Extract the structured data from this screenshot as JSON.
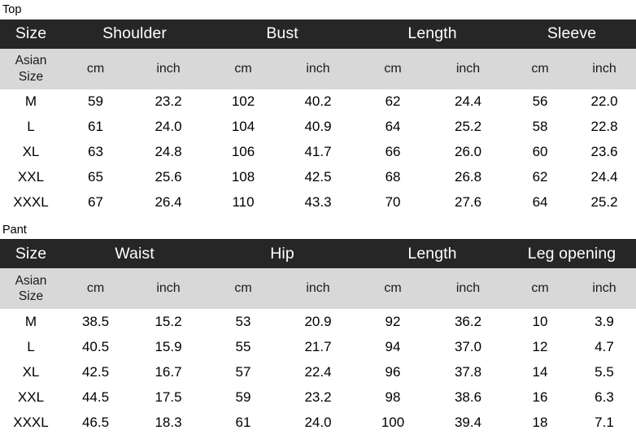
{
  "tables": [
    {
      "label": "Top",
      "group_headers": [
        "Size",
        "Shoulder",
        "Bust",
        "Length",
        "Sleeve"
      ],
      "size_header": "Asian\nSize",
      "size_header_line1": "Asian",
      "size_header_line2": "Size",
      "unit_headers": [
        "cm",
        "inch",
        "cm",
        "inch",
        "cm",
        "inch",
        "cm",
        "inch"
      ],
      "rows": [
        {
          "size": "M",
          "cells": [
            "59",
            "23.2",
            "102",
            "40.2",
            "62",
            "24.4",
            "56",
            "22.0"
          ]
        },
        {
          "size": "L",
          "cells": [
            "61",
            "24.0",
            "104",
            "40.9",
            "64",
            "25.2",
            "58",
            "22.8"
          ]
        },
        {
          "size": "XL",
          "cells": [
            "63",
            "24.8",
            "106",
            "41.7",
            "66",
            "26.0",
            "60",
            "23.6"
          ]
        },
        {
          "size": "XXL",
          "cells": [
            "65",
            "25.6",
            "108",
            "42.5",
            "68",
            "26.8",
            "62",
            "24.4"
          ]
        },
        {
          "size": "XXXL",
          "cells": [
            "67",
            "26.4",
            "110",
            "43.3",
            "70",
            "27.6",
            "64",
            "25.2"
          ]
        }
      ]
    },
    {
      "label": "Pant",
      "group_headers": [
        "Size",
        "Waist",
        "Hip",
        "Length",
        "Leg opening"
      ],
      "size_header_line1": "Asian",
      "size_header_line2": "Size",
      "unit_headers": [
        "cm",
        "inch",
        "cm",
        "inch",
        "cm",
        "inch",
        "cm",
        "inch"
      ],
      "rows": [
        {
          "size": "M",
          "cells": [
            "38.5",
            "15.2",
            "53",
            "20.9",
            "92",
            "36.2",
            "10",
            "3.9"
          ]
        },
        {
          "size": "L",
          "cells": [
            "40.5",
            "15.9",
            "55",
            "21.7",
            "94",
            "37.0",
            "12",
            "4.7"
          ]
        },
        {
          "size": "XL",
          "cells": [
            "42.5",
            "16.7",
            "57",
            "22.4",
            "96",
            "37.8",
            "14",
            "5.5"
          ]
        },
        {
          "size": "XXL",
          "cells": [
            "44.5",
            "17.5",
            "59",
            "23.2",
            "98",
            "38.6",
            "16",
            "6.3"
          ]
        },
        {
          "size": "XXXL",
          "cells": [
            "46.5",
            "18.3",
            "61",
            "24.0",
            "100",
            "39.4",
            "18",
            "7.1"
          ]
        }
      ]
    }
  ],
  "colors": {
    "header_band": "#262626",
    "unit_band": "#d8d8d8",
    "body_bg": "#ffffff",
    "text": "#000000",
    "header_text": "#ffffff"
  }
}
